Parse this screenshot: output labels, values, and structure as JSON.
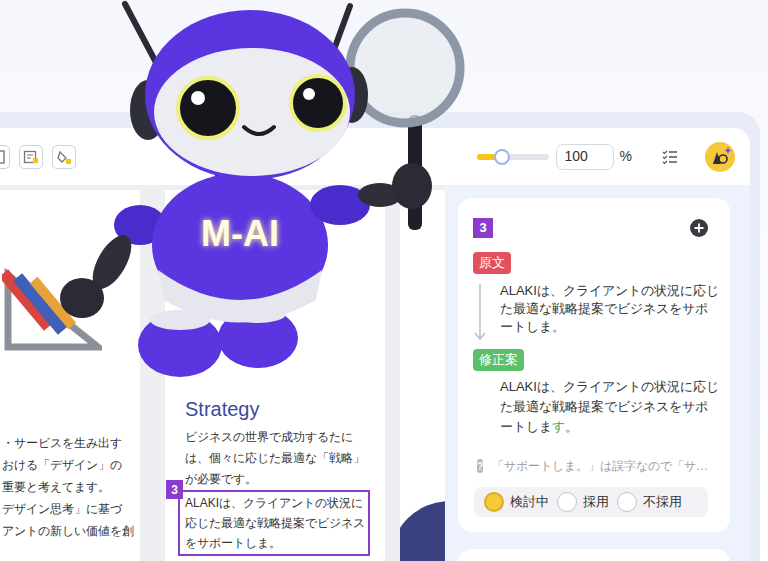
{
  "mascot": {
    "label": "M-AI"
  },
  "toolbar": {
    "zoom": {
      "level": 0.35,
      "value": "100",
      "unit": "%"
    }
  },
  "document": {
    "pages": [
      {
        "lines": [
          "・サービスを生み出す",
          "おける「デザイン」の",
          "重要と考えてます。",
          "デザイン思考」に基づ",
          "アントの新しい価値を創"
        ]
      },
      {
        "heading": "Strategy",
        "lines": [
          "ビジネスの世界で成功するたに",
          "は、個々に応じた最適な「戦略」",
          "が必要です。"
        ],
        "highlight": {
          "badge": "3",
          "lines": [
            "ALAKIは、クライアントの状況に",
            "応じた最適な戦略提案でビジネス",
            "をサポートしま。"
          ]
        }
      }
    ]
  },
  "suggestions": [
    {
      "badge": "3",
      "original": {
        "label": "原文",
        "lines": [
          "ALAKIは、クライアントの状況に応じ",
          "た最適な戦略提案でビジネスをサポ",
          "ートしま。"
        ]
      },
      "revised": {
        "label": "修正案",
        "lines": [
          {
            "segments": [
              {
                "text": "ALAKIは、クライアントの状況に応じ",
                "changed": false
              }
            ]
          },
          {
            "segments": [
              {
                "text": "た最適な戦略提案でビジネスをサポ",
                "changed": false
              }
            ]
          },
          {
            "segments": [
              {
                "text": "ートしま",
                "changed": false
              },
              {
                "text": "す",
                "changed": true
              },
              {
                "text": "。",
                "changed": false
              }
            ]
          }
        ]
      },
      "hint": {
        "icon": "?",
        "text": "「サポートしま。」は誤字なので「サ…"
      },
      "status_options": [
        {
          "label": "検討中",
          "selected": true
        },
        {
          "label": "採用",
          "selected": false
        },
        {
          "label": "不採用",
          "selected": false
        }
      ]
    }
  ]
}
